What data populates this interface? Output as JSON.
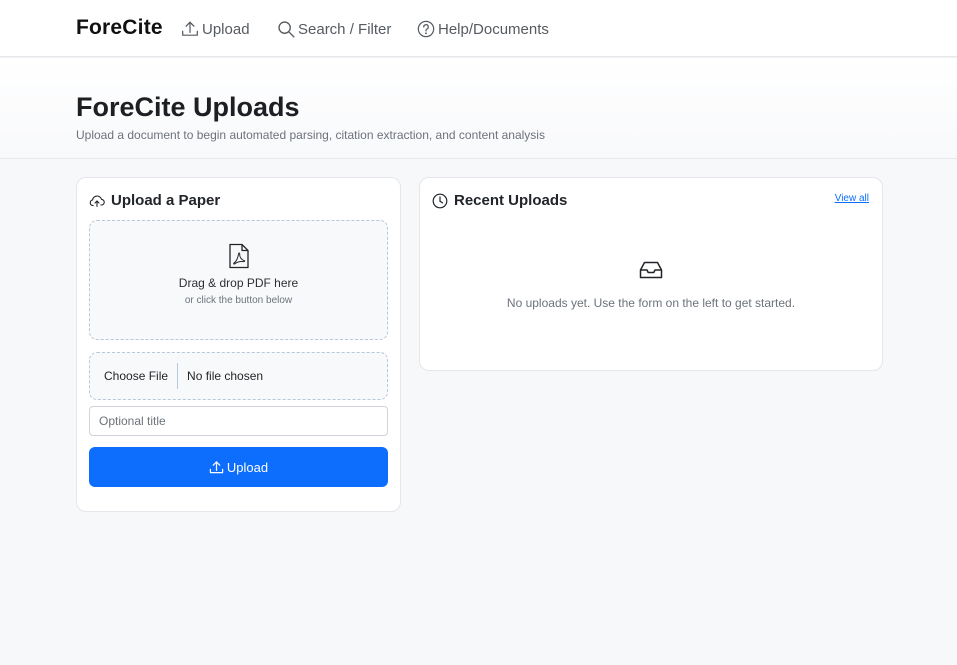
{
  "nav": {
    "brand": "ForeCite",
    "links": [
      {
        "label": "Upload",
        "icon": "upload-icon"
      },
      {
        "label": "Search / Filter",
        "icon": "search-icon"
      },
      {
        "label": "Help/Documents",
        "icon": "question-circle-icon"
      }
    ]
  },
  "header": {
    "title": "ForeCite Uploads",
    "subtitle": "Upload a document to begin automated parsing, citation extraction, and content analysis"
  },
  "upload_card": {
    "title": "Upload a Paper",
    "icon": "cloud-upload-icon",
    "dropzone": {
      "icon": "pdf-file-icon",
      "main_text": "Drag & drop PDF here",
      "sub_text": "or click the button below"
    },
    "file_input": {
      "button_label": "Choose File",
      "status": "No file chosen"
    },
    "title_input": {
      "value": "",
      "placeholder": "Optional title"
    },
    "submit_label": "Upload"
  },
  "recent_card": {
    "title": "Recent Uploads",
    "icon": "clock-icon",
    "view_all_label": "View all",
    "empty_icon": "inbox-icon",
    "empty_text": "No uploads yet. Use the form on the left to get started."
  },
  "colors": {
    "primary": "#0d6efd",
    "background": "#f7f8fa",
    "card": "#ffffff",
    "dashed_border": "#b9c6dc"
  }
}
